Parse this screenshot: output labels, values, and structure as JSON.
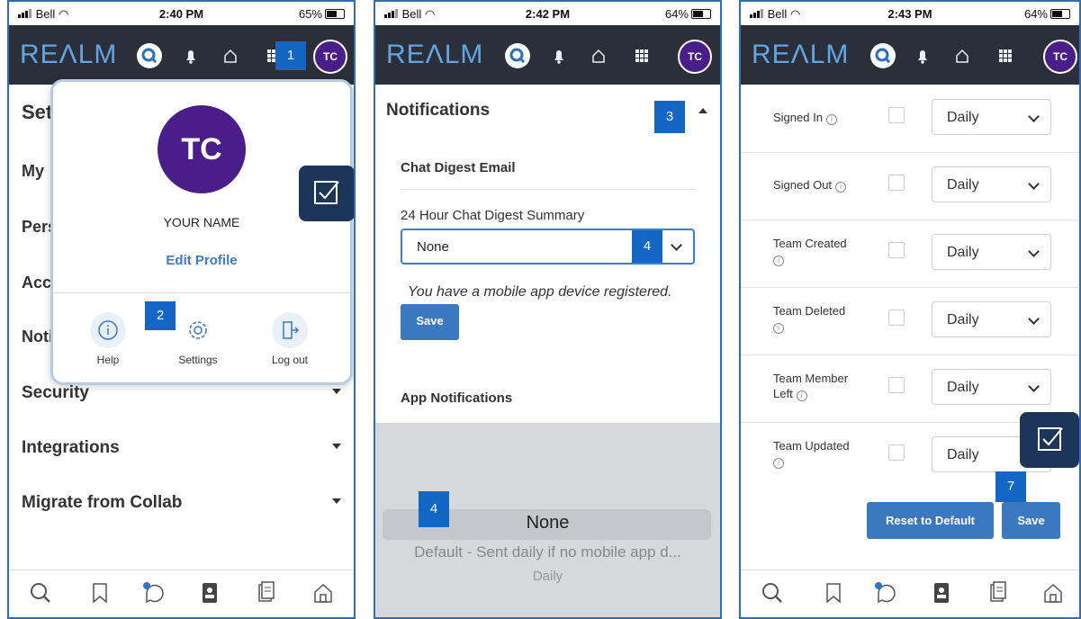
{
  "panel1": {
    "status": {
      "carrier": "Bell",
      "time": "2:40 PM",
      "battery": "65%",
      "battery_level": 0.65
    },
    "logo": "REΛLM",
    "avatar_initials": "TC",
    "callout_1": "1",
    "settings_title": "Set",
    "side_rows": [
      "My",
      "Pers",
      "Acc",
      "Noti"
    ],
    "sections": [
      "Security",
      "Integrations",
      "Migrate from Collab"
    ],
    "popup": {
      "initials": "TC",
      "name": "YOUR NAME",
      "edit_profile": "Edit Profile",
      "callout_2": "2",
      "actions": [
        {
          "label": "Help",
          "icon": "info-icon"
        },
        {
          "label": "Settings",
          "icon": "gear-icon"
        },
        {
          "label": "Log out",
          "icon": "logout-icon"
        }
      ]
    }
  },
  "panel2": {
    "status": {
      "carrier": "Bell",
      "time": "2:42 PM",
      "battery": "64%",
      "battery_level": 0.64
    },
    "logo": "REΛLM",
    "avatar_initials": "TC",
    "notifications": "Notifications",
    "callout_3": "3",
    "chat_digest_email": "Chat Digest Email",
    "digest_label": "24 Hour Chat Digest Summary",
    "digest_value": "None",
    "callout_4a": "4",
    "mobile_note": "You have a mobile app device registered.",
    "save": "Save",
    "app_notifications": "App Notifications",
    "picker": {
      "callout_4b": "4",
      "selected": "None",
      "option_2": "Default - Sent daily if no mobile app d...",
      "option_3": "Daily"
    }
  },
  "panel3": {
    "status": {
      "carrier": "Bell",
      "time": "2:43 PM",
      "battery": "64%",
      "battery_level": 0.64
    },
    "logo": "REΛLM",
    "avatar_initials": "TC",
    "rows": [
      {
        "label": "Signed In",
        "value": "Daily"
      },
      {
        "label": "Signed Out",
        "value": "Daily"
      },
      {
        "label": "Team Created",
        "value": "Daily"
      },
      {
        "label": "Team Deleted",
        "value": "Daily"
      },
      {
        "label": "Team Member Left",
        "value": "Daily"
      },
      {
        "label": "Team Updated",
        "value": "Daily"
      }
    ],
    "callout_7": "7",
    "reset": "Reset to Default",
    "save": "Save"
  },
  "colors": {
    "appbar": "#2b2f3a",
    "accent": "#3a78c0",
    "avatar": "#4a1e8a",
    "callout": "#1366c4"
  }
}
